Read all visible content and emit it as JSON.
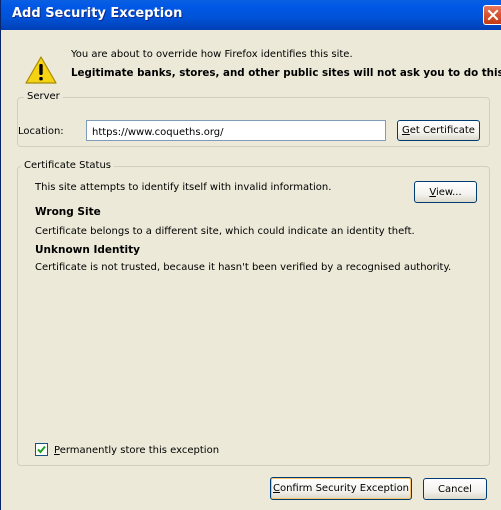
{
  "window": {
    "title": "Add Security Exception"
  },
  "intro": {
    "line1": "You are about to override how Firefox identifies this site.",
    "line2": "Legitimate banks, stores, and other public sites will not ask you to do this."
  },
  "server": {
    "legend": "Server",
    "location_label": "Location:",
    "location_value": "https://www.coqueths.org/",
    "get_certificate_prefix": "",
    "get_certificate_mnemonic": "G",
    "get_certificate_rest": "et Certificate"
  },
  "certificate_status": {
    "legend": "Certificate Status",
    "summary": "This site attempts to identify itself with invalid information.",
    "view_mnemonic": "V",
    "view_rest": "iew...",
    "wrong_site_heading": "Wrong Site",
    "wrong_site_desc": "Certificate belongs to a different site, which could indicate an identity theft.",
    "unknown_identity_heading": "Unknown Identity",
    "unknown_identity_desc": "Certificate is not trusted, because it hasn't been verified by a recognised authority."
  },
  "permanent": {
    "checked": true,
    "label_mnemonic": "P",
    "label_rest": "ermanently store this exception"
  },
  "buttons": {
    "confirm_mnemonic": "C",
    "confirm_rest": "onfirm Security Exception",
    "cancel": "Cancel"
  },
  "colors": {
    "titlebar": "#0058e6",
    "dialog_bg": "#ece9d8",
    "warning_yellow": "#f5d312",
    "close_red": "#d5532e"
  },
  "icons": {
    "warning": "warning-icon",
    "close": "close-icon",
    "checkmark": "checkmark-icon"
  }
}
